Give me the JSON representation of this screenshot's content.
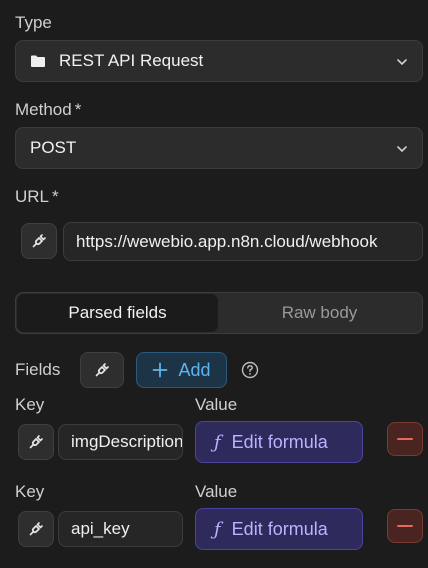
{
  "type": {
    "label": "Type",
    "value": "REST API Request",
    "icon": "folder-icon"
  },
  "method": {
    "label": "Method",
    "required_mark": "*",
    "value": "POST"
  },
  "url": {
    "label": "URL",
    "required_mark": "*",
    "value": "https://wewebio.app.n8n.cloud/webhook"
  },
  "body_tabs": {
    "parsed": "Parsed fields",
    "raw": "Raw body",
    "active": "parsed"
  },
  "fields": {
    "label": "Fields",
    "add_label": "Add",
    "rows": [
      {
        "key_label": "Key",
        "value_label": "Value",
        "key": "imgDescription",
        "formula_label": "Edit formula"
      },
      {
        "key_label": "Key",
        "value_label": "Value",
        "key": "api_key",
        "formula_label": "Edit formula"
      }
    ]
  },
  "colors": {
    "accent": "#4aa8e8",
    "formula": "#2f2a5c",
    "danger": "#e46a5a"
  }
}
